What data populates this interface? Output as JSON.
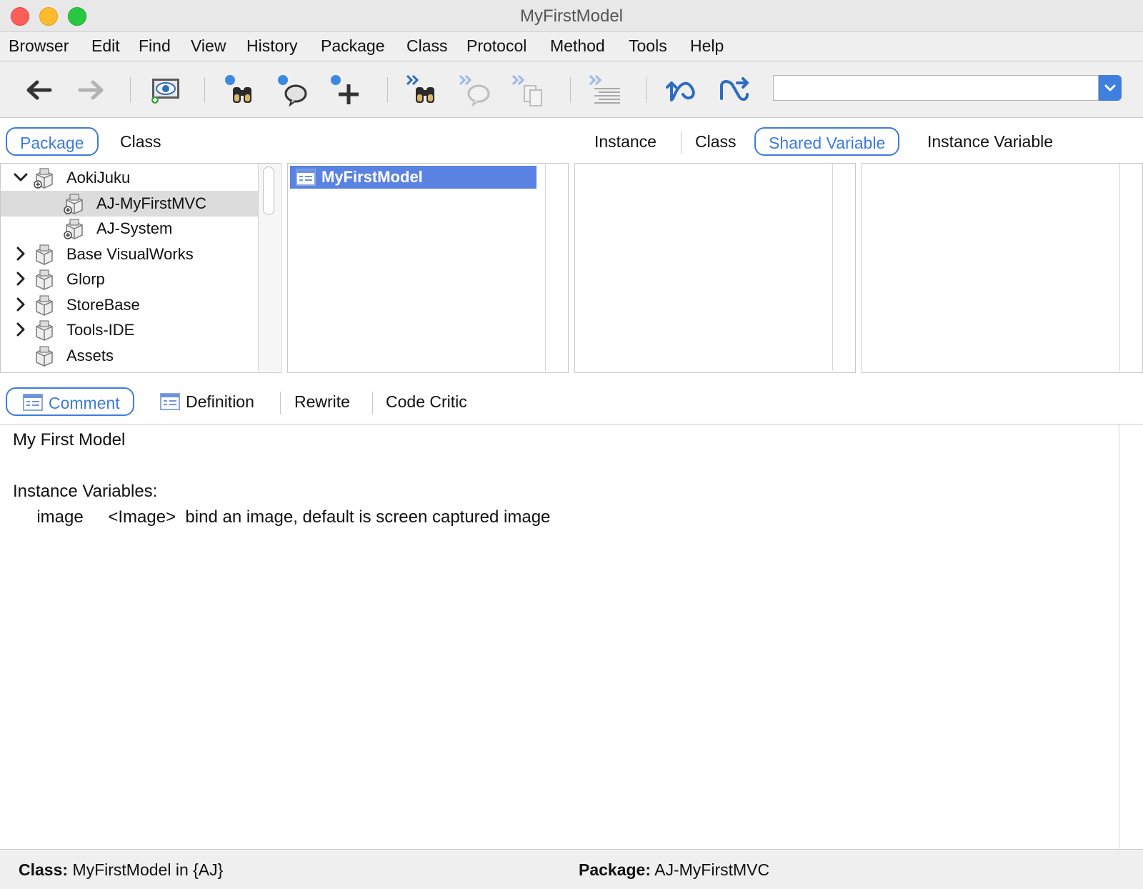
{
  "window": {
    "title": "MyFirstModel"
  },
  "menu": [
    "Browser",
    "Edit",
    "Find",
    "View",
    "History",
    "Package",
    "Class",
    "Protocol",
    "Method",
    "Tools",
    "Help"
  ],
  "toolbar": {
    "icons": [
      "back-arrow",
      "forward-arrow",
      "browse-eye",
      "find-package",
      "find-class-bubble",
      "add-item",
      "find-next",
      "next-bubble",
      "next-copy",
      "format-lines",
      "refactor-rename",
      "refactor-shuffle"
    ],
    "search_value": ""
  },
  "nav_tabs": {
    "package": "Package",
    "class": "Class"
  },
  "var_tabs": {
    "instance": "Instance",
    "class": "Class",
    "shared": "Shared Variable",
    "instance_var": "Instance Variable"
  },
  "package_tree": [
    {
      "label": "AokiJuku",
      "indent": 0,
      "expander": "expanded",
      "selected": false
    },
    {
      "label": "AJ-MyFirstMVC",
      "indent": 1,
      "expander": "none",
      "selected": true
    },
    {
      "label": "AJ-System",
      "indent": 1,
      "expander": "none",
      "selected": false
    },
    {
      "label": "Base VisualWorks",
      "indent": 0,
      "expander": "collapsed",
      "selected": false
    },
    {
      "label": "Glorp",
      "indent": 0,
      "expander": "collapsed",
      "selected": false
    },
    {
      "label": "StoreBase",
      "indent": 0,
      "expander": "collapsed",
      "selected": false
    },
    {
      "label": "Tools-IDE",
      "indent": 0,
      "expander": "collapsed",
      "selected": false
    },
    {
      "label": "Assets",
      "indent": 0,
      "expander": "none",
      "selected": false
    }
  ],
  "class_list": [
    "MyFirstModel"
  ],
  "code_tabs": {
    "comment": "Comment",
    "definition": "Definition",
    "rewrite": "Rewrite",
    "critic": "Code Critic"
  },
  "comment": {
    "line1": "My First Model",
    "line2": "",
    "line3": "Instance Variables:",
    "line4": "\timage\t<Image>  bind an image, default is screen captured image"
  },
  "status": {
    "class_label": "Class:",
    "class_value": "MyFirstModel in {AJ}",
    "package_label": "Package:",
    "package_value": "AJ-MyFirstMVC"
  },
  "colors": {
    "accent": "#3d7be0",
    "selection": "#5a82e2",
    "tree_selection": "#dcdcdc"
  }
}
